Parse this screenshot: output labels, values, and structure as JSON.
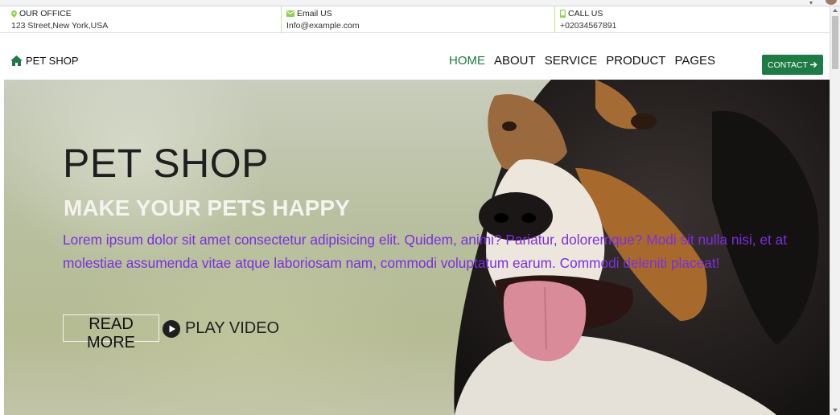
{
  "topbar": {
    "office": {
      "title": "OUR OFFICE",
      "value": "123 Street,New York,USA"
    },
    "email": {
      "title": "Email US",
      "value": "Info@example.com"
    },
    "call": {
      "title": "CALL US",
      "value": "+02034567891"
    }
  },
  "brand": {
    "name": "PET SHOP"
  },
  "nav": {
    "items": [
      {
        "label": "HOME",
        "active": true
      },
      {
        "label": "ABOUT",
        "active": false
      },
      {
        "label": "SERVICE",
        "active": false
      },
      {
        "label": "PRODUCT",
        "active": false
      },
      {
        "label": "PAGES",
        "active": false
      }
    ]
  },
  "contact_button": {
    "label": "CONTACT",
    "icon": "arrow-right-icon"
  },
  "hero": {
    "title": "PET SHOP",
    "subtitle": "MAKE YOUR PETS HAPPY",
    "text": "Lorem ipsum dolor sit amet consectetur adipisicing elit. Quidem, animi? Pariatur, doloremque? Modi sit nulla nisi, et at molestiae assumenda vitae atque laboriosam nam, commodi voluptatum earum. Commodi deleniti placeat!",
    "read_more": "READ MORE",
    "play_video": "PLAY VIDEO",
    "image": "dog-photo"
  },
  "colors": {
    "accent": "#1e7b45",
    "active_nav": "#1a7a3e",
    "hero_text": "#7b2fe0",
    "icon_green": "#8fd14f"
  }
}
